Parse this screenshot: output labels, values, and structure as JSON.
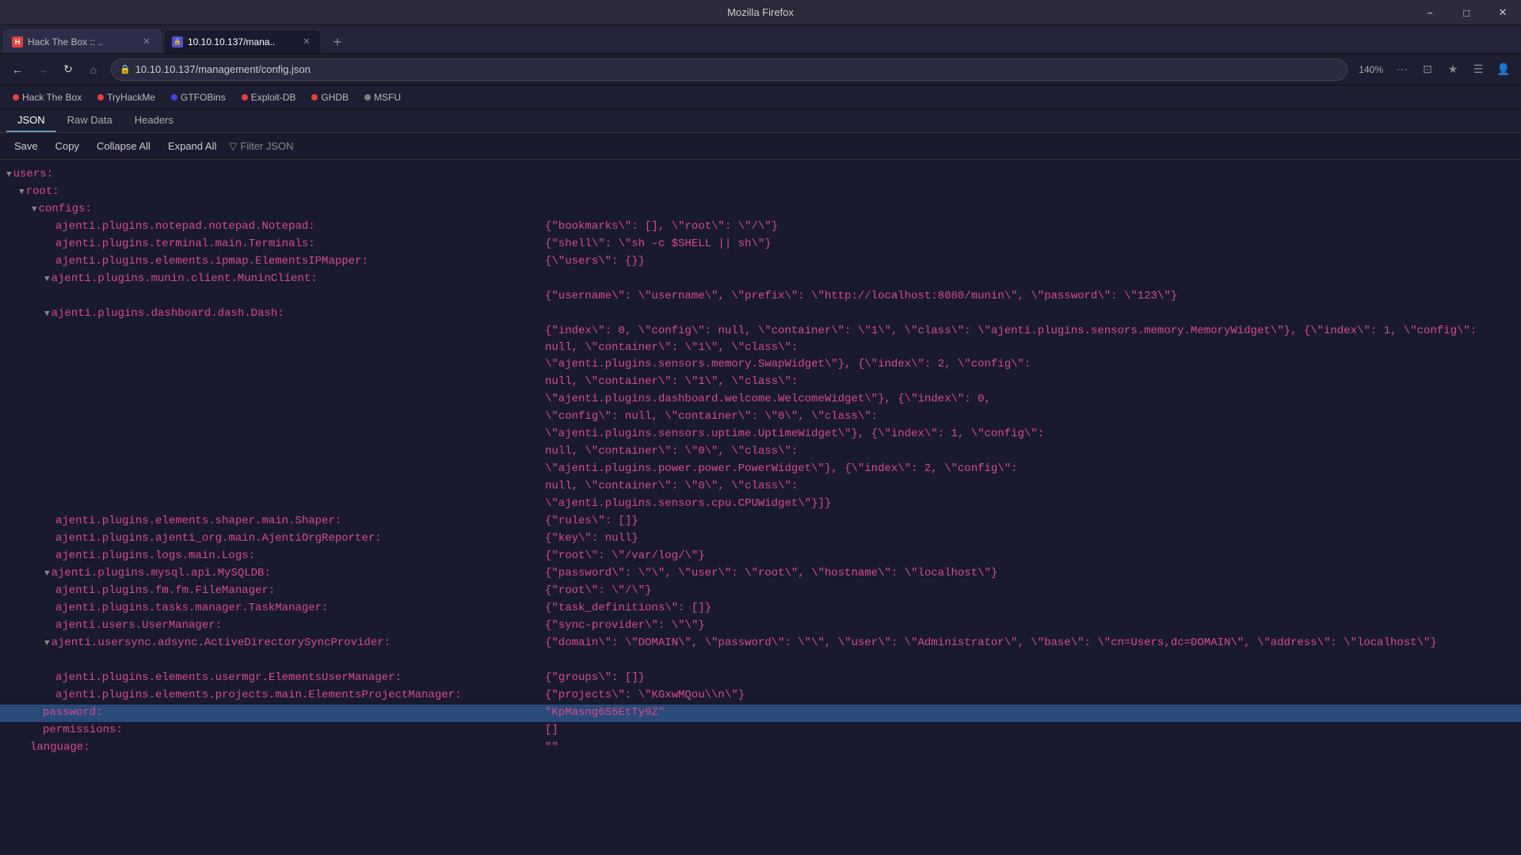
{
  "window": {
    "title": "Mozilla Firefox"
  },
  "tabs": [
    {
      "id": "tab1",
      "label": "Hack The Box :: ..",
      "favicon_color": "#e04040",
      "active": false,
      "closeable": true
    },
    {
      "id": "tab2",
      "label": "10.10.10.137/mana..",
      "favicon_color": "#5050d0",
      "active": true,
      "closeable": true
    }
  ],
  "nav": {
    "back_enabled": true,
    "forward_enabled": false,
    "url": "10.10.10.137/management/config.json",
    "zoom": "140%"
  },
  "bookmarks": [
    {
      "label": "Hack The Box",
      "color": "#e04040"
    },
    {
      "label": "TryHackMe",
      "color": "#e04040"
    },
    {
      "label": "GTFOBins",
      "color": "#4040e0"
    },
    {
      "label": "Exploit-DB",
      "color": "#e04040"
    },
    {
      "label": "GHDB",
      "color": "#e04040"
    },
    {
      "label": "MSFU",
      "color": "#808080"
    }
  ],
  "json_viewer": {
    "tabs": [
      "JSON",
      "Raw Data",
      "Headers"
    ],
    "active_tab": "JSON",
    "actions": [
      "Save",
      "Copy",
      "Collapse All",
      "Expand All"
    ],
    "filter_label": "Filter JSON"
  },
  "json_data": {
    "lines": [
      {
        "indent": 0,
        "arrow": "down",
        "left": "users:",
        "right": ""
      },
      {
        "indent": 1,
        "arrow": "down",
        "left": "root:",
        "right": ""
      },
      {
        "indent": 2,
        "arrow": "down",
        "left": "configs:",
        "right": ""
      },
      {
        "indent": 3,
        "arrow": "",
        "left": "ajenti.plugins.notepad.notepad.Notepad:",
        "right": "{\"bookmarks\\\": [], \\\"root\\\": \\\"/\\\"}"
      },
      {
        "indent": 3,
        "arrow": "",
        "left": "ajenti.plugins.terminal.main.Terminals:",
        "right": "{\"shell\\\": \\\"sh -c $SHELL || sh\\\"}"
      },
      {
        "indent": 3,
        "arrow": "",
        "left": "ajenti.plugins.elements.ipmap.ElementsIPMapper:",
        "right": "{\\\"users\\\": {}}"
      },
      {
        "indent": 3,
        "arrow": "down",
        "left": "ajenti.plugins.munin.client.MuninClient:",
        "right": ""
      },
      {
        "indent": 4,
        "arrow": "",
        "left": "",
        "right": "{\"username\\\": \\\"username\\\", \\\"prefix\\\": \\\"http://localhost:8080/munin\\\", \\\"password\\\": \\\"123\\\"}"
      },
      {
        "indent": 3,
        "arrow": "down",
        "left": "ajenti.plugins.dashboard.dash.Dash:",
        "right": ""
      },
      {
        "indent": 4,
        "arrow": "",
        "left": "",
        "right": "{\"index\\\": 0, \\\"config\\\": null, \\\"container\\\": \\\"1\\\", \\\"class\\\": \\\"ajenti.plugins.sensors.memory.MemoryWidget\\\"}, {\\\"index\\\": 1, \\\"config\\\": null, \\\"container\\\": \\\"1\\\", \\\"class\\\":"
      },
      {
        "indent": 4,
        "arrow": "",
        "left": "",
        "right": "\\\"ajenti.plugins.sensors.memory.SwapWidget\\\"}, {\\\"index\\\": 2, \\\"config\\\":"
      },
      {
        "indent": 4,
        "arrow": "",
        "left": "",
        "right": "null, \\\"container\\\": \\\"1\\\", \\\"class\\\":"
      },
      {
        "indent": 4,
        "arrow": "",
        "left": "",
        "right": "\\\"ajenti.plugins.dashboard.welcome.WelcomeWidget\\\"}, {\\\"index\\\": 0,"
      },
      {
        "indent": 4,
        "arrow": "",
        "left": "",
        "right": "\\\"config\\\": null, \\\"container\\\": \\\"0\\\", \\\"class\\\":"
      },
      {
        "indent": 4,
        "arrow": "",
        "left": "",
        "right": "\\\"ajenti.plugins.sensors.uptime.UptimeWidget\\\"}, {\\\"index\\\": 1, \\\"config\\\":"
      },
      {
        "indent": 4,
        "arrow": "",
        "left": "",
        "right": "null, \\\"container\\\": \\\"0\\\", \\\"class\\\":"
      },
      {
        "indent": 4,
        "arrow": "",
        "left": "",
        "right": "\\\"ajenti.plugins.power.power.PowerWidget\\\"}, {\\\"index\\\": 2, \\\"config\\\":"
      },
      {
        "indent": 4,
        "arrow": "",
        "left": "",
        "right": "null, \\\"container\\\": \\\"0\\\", \\\"class\\\":"
      },
      {
        "indent": 4,
        "arrow": "",
        "left": "",
        "right": "\\\"ajenti.plugins.sensors.cpu.CPUWidget\\\"}]}"
      },
      {
        "indent": 3,
        "arrow": "",
        "left": "ajenti.plugins.elements.shaper.main.Shaper:",
        "right": "{\"rules\\\": []}"
      },
      {
        "indent": 3,
        "arrow": "",
        "left": "ajenti.plugins.ajenti_org.main.AjentiOrgReporter:",
        "right": "{\"key\\\": null}"
      },
      {
        "indent": 3,
        "arrow": "",
        "left": "ajenti.plugins.logs.main.Logs:",
        "right": "{\"root\\\": \\\"/var/log/\\\"}"
      },
      {
        "indent": 3,
        "arrow": "down",
        "left": "ajenti.plugins.mysql.api.MySQLDB:",
        "right": "{\"password\\\": \\\"\\\", \\\"user\\\": \\\"root\\\", \\\"hostname\\\": \\\"localhost\\\"}"
      },
      {
        "indent": 3,
        "arrow": "",
        "left": "ajenti.plugins.fm.fm.FileManager:",
        "right": "{\"root\\\": \\\"/\\\"}"
      },
      {
        "indent": 3,
        "arrow": "",
        "left": "ajenti.plugins.tasks.manager.TaskManager:",
        "right": "{\"task_definitions\\\": []}"
      },
      {
        "indent": 3,
        "arrow": "",
        "left": "ajenti.users.UserManager:",
        "right": "{\"sync-provider\\\": \\\"\\\"}"
      },
      {
        "indent": 3,
        "arrow": "down",
        "left": "ajenti.usersync.adsync.ActiveDirectorySyncProvider:",
        "right": "{\"domain\\\": \\\"DOMAIN\\\", \\\"password\\\": \\\"\\\", \\\"user\\\": \\\"Administrator\\\", \\\"base\\\": \\\"cn=Users,dc=DOMAIN\\\", \\\"address\\\": \\\"localhost\\\"}"
      },
      {
        "indent": 4,
        "arrow": "",
        "left": "",
        "right": ""
      },
      {
        "indent": 3,
        "arrow": "",
        "left": "ajenti.plugins.elements.usermgr.ElementsUserManager:",
        "right": "{\"groups\\\": []}"
      },
      {
        "indent": 3,
        "arrow": "",
        "left": "ajenti.plugins.elements.projects.main.ElementsProjectManager:",
        "right": "{\"projects\\\": \\\"KGxwMQou\\\\n\\\"}"
      },
      {
        "indent": 2,
        "arrow": "",
        "left": "password:",
        "right": "\"KpMasng6S5EtTy9Z\"",
        "highlighted": true
      },
      {
        "indent": 2,
        "arrow": "",
        "left": "permissions:",
        "right": "[]"
      },
      {
        "indent": 1,
        "arrow": "",
        "left": "language:",
        "right": "\"\""
      }
    ]
  }
}
